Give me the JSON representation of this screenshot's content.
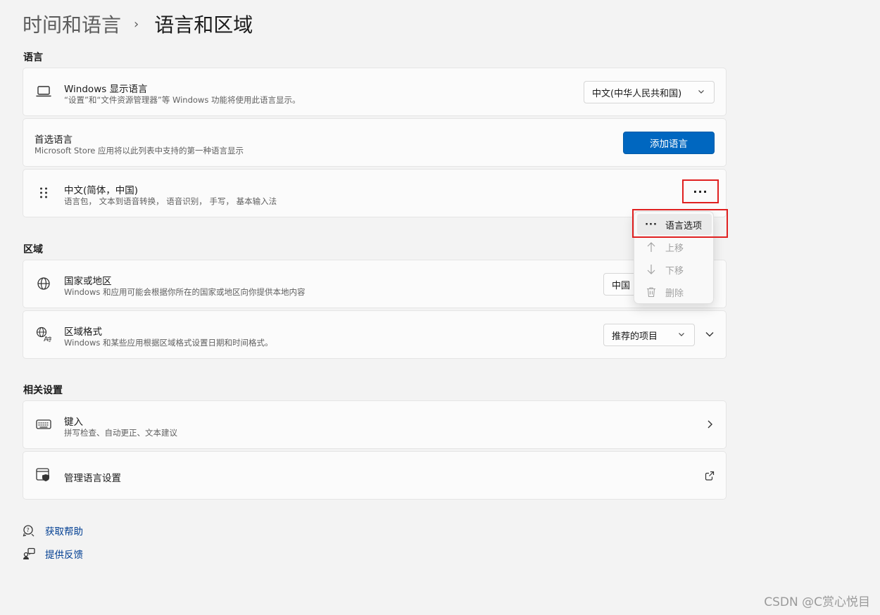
{
  "breadcrumb": {
    "parent": "时间和语言",
    "separator": "›",
    "current": "语言和区域"
  },
  "sections": {
    "language": "语言",
    "region": "区域",
    "related": "相关设置"
  },
  "display_language": {
    "title": "Windows 显示语言",
    "subtitle": "“设置”和“文件资源管理器”等 Windows 功能将使用此语言显示。",
    "value": "中文(中华人民共和国)",
    "icon": "laptop-icon"
  },
  "preferred_language": {
    "title": "首选语言",
    "subtitle": "Microsoft Store 应用将以此列表中支持的第一种语言显示",
    "add_button": "添加语言"
  },
  "installed_language": {
    "title": "中文(简体，中国)",
    "subtitle": "语言包， 文本到语音转换， 语音识别， 手写， 基本输入法",
    "more_label": "···"
  },
  "flyout": {
    "options": "语言选项",
    "up": "上移",
    "down": "下移",
    "delete": "删除",
    "options_icon": "···"
  },
  "country": {
    "title": "国家或地区",
    "subtitle": "Windows 和应用可能会根据你所在的国家或地区向你提供本地内容",
    "value": "中国"
  },
  "regional_format": {
    "title": "区域格式",
    "subtitle": "Windows 和某些应用根据区域格式设置日期和时间格式。",
    "value": "推荐的项目"
  },
  "typing": {
    "title": "键入",
    "subtitle": "拼写检查、自动更正、文本建议"
  },
  "admin": {
    "title": "管理语言设置"
  },
  "links": {
    "help": "获取帮助",
    "feedback": "提供反馈"
  },
  "watermark": "CSDN @C赏心悦目",
  "colors": {
    "accent": "#0067c0",
    "highlight": "#e02020",
    "link": "#003e92"
  }
}
